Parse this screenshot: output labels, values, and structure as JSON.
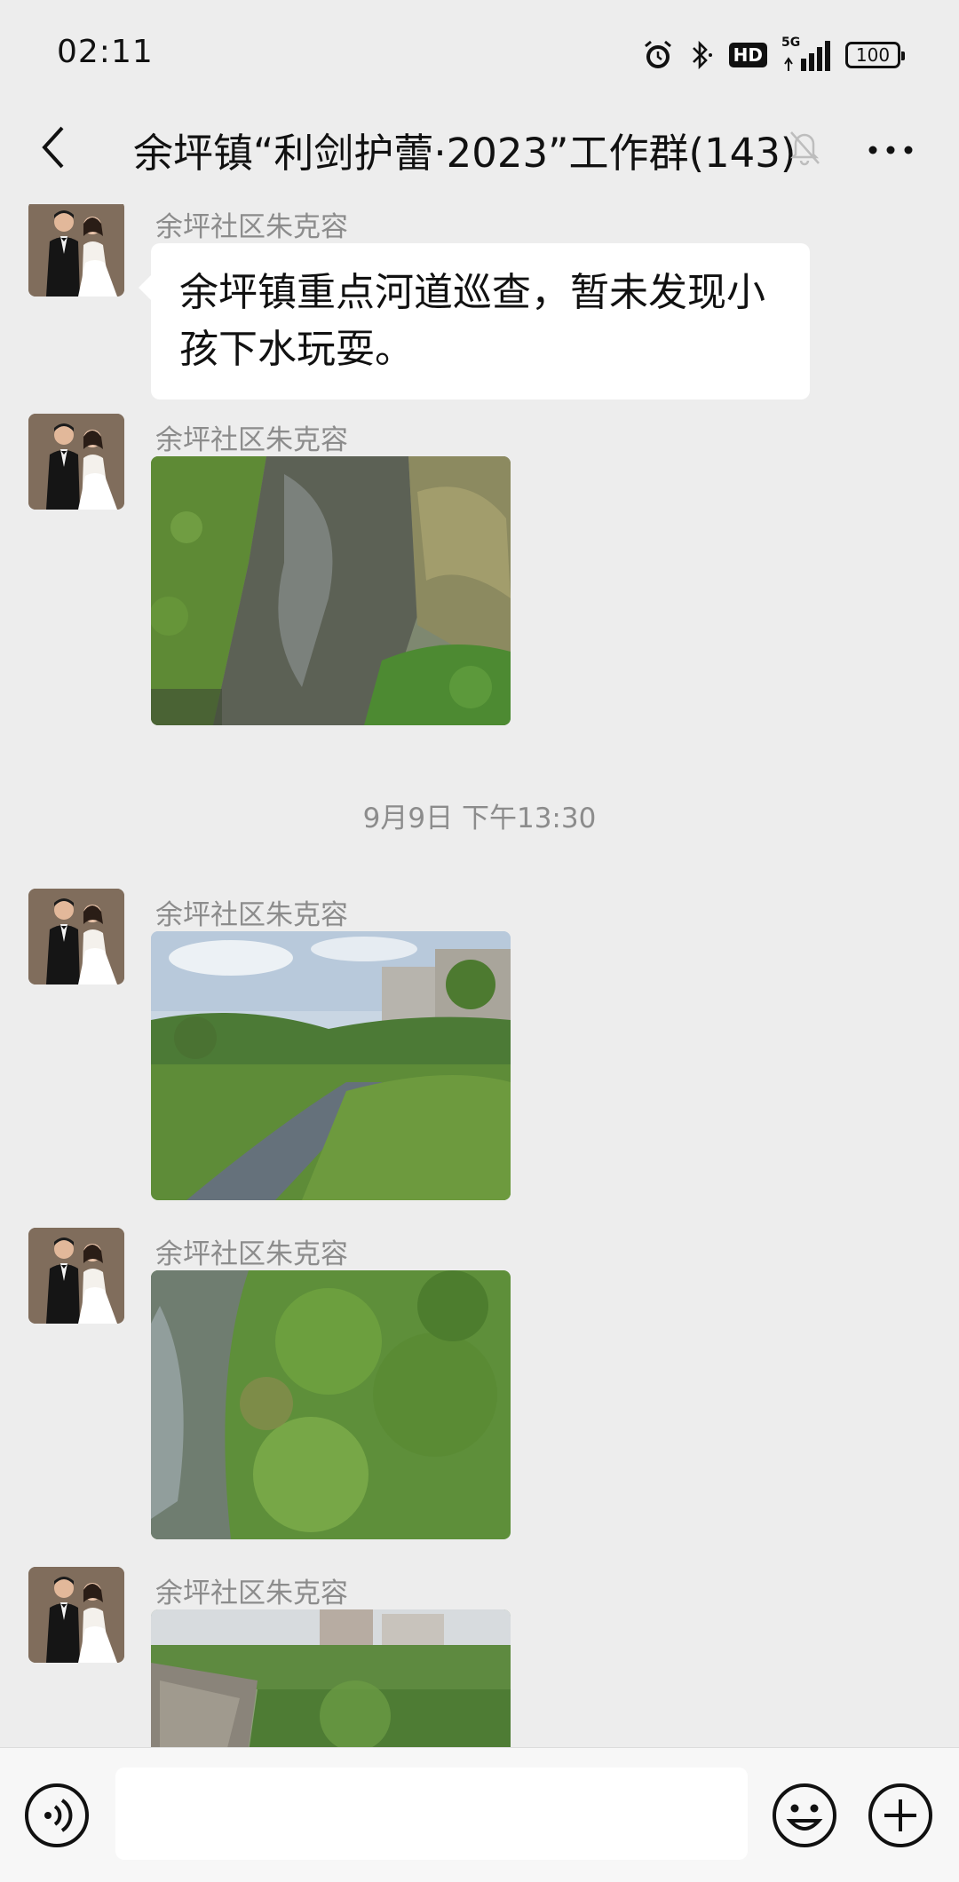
{
  "status_bar": {
    "time": "02:11",
    "network_label": "5G",
    "hd_label": "HD",
    "battery": "100"
  },
  "header": {
    "title": "余坪镇“利剑护蕾·2023”工作群(143)",
    "back_icon": "chevron-left-icon",
    "mute_icon": "bell-muted-icon",
    "more_icon": "ellipsis-icon"
  },
  "messages": [
    {
      "type": "text",
      "sender": "余坪社区朱克容",
      "text": "余坪镇重点河道巡查，暂未发现小孩下水玩耍。"
    },
    {
      "type": "image",
      "sender": "余坪社区朱克容"
    },
    {
      "type": "time",
      "text": "9月9日 下午13:30"
    },
    {
      "type": "image",
      "sender": "余坪社区朱克容"
    },
    {
      "type": "image",
      "sender": "余坪社区朱克容"
    },
    {
      "type": "image",
      "sender": "余坪社区朱克容"
    }
  ],
  "input_bar": {
    "voice_icon": "voice-icon",
    "emoji_icon": "emoji-icon",
    "plus_icon": "plus-icon",
    "input_value": ""
  }
}
